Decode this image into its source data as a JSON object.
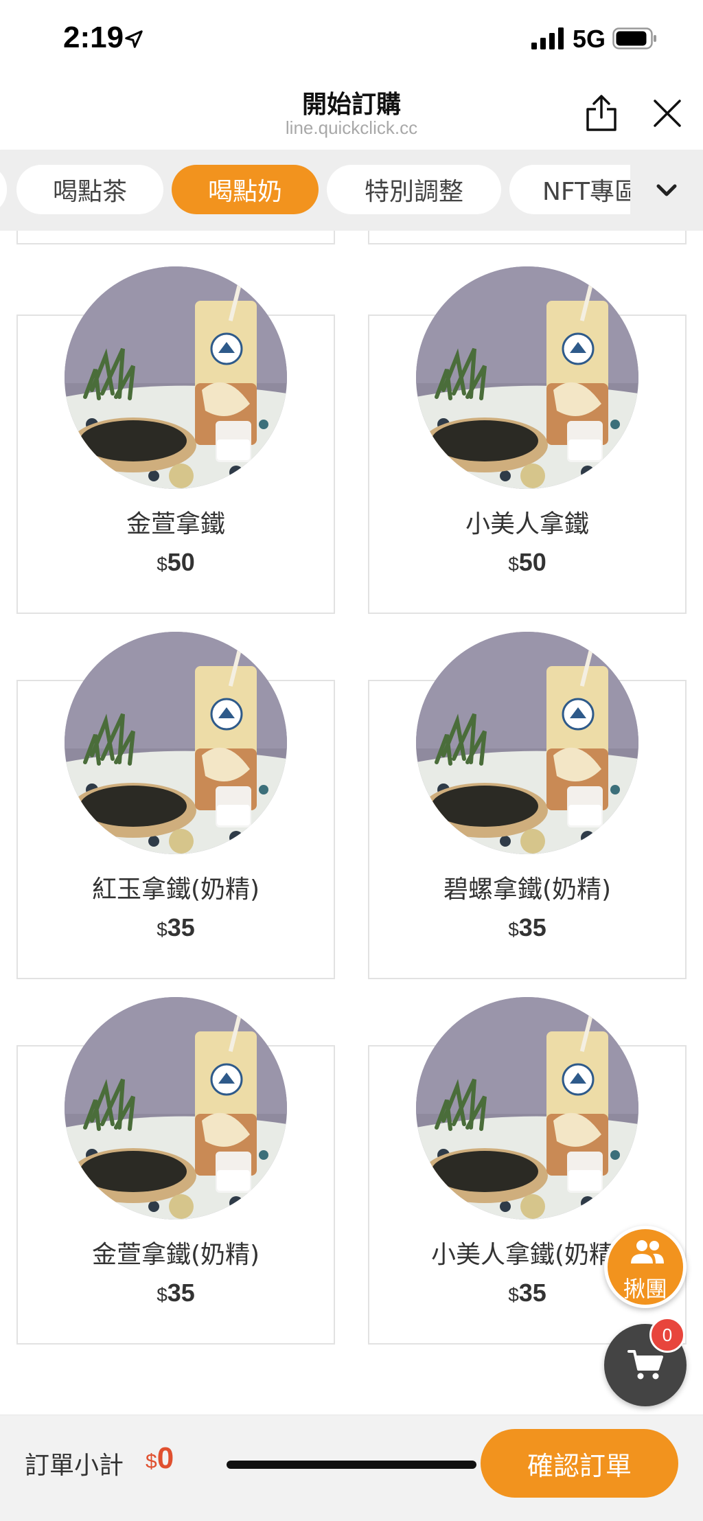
{
  "status_bar": {
    "time": "2:19",
    "network": "5G",
    "icons": [
      "location-arrow-icon",
      "signal-bars-icon",
      "battery-icon"
    ]
  },
  "header": {
    "title": "開始訂購",
    "url": "line.quickclick.cc",
    "icons": [
      "share-icon",
      "close-icon"
    ]
  },
  "tabs": {
    "items": [
      {
        "label": "喝點茶",
        "active": false
      },
      {
        "label": "喝點奶",
        "active": true
      },
      {
        "label": "特別調整",
        "active": false
      },
      {
        "label": "NFT專區",
        "active": false
      }
    ],
    "more_icon": "chevron-down-icon"
  },
  "products": [
    {
      "name": "金萱拿鐵",
      "currency": "$",
      "price": "50"
    },
    {
      "name": "小美人拿鐵",
      "currency": "$",
      "price": "50"
    },
    {
      "name": "紅玉拿鐵(奶精)",
      "currency": "$",
      "price": "35"
    },
    {
      "name": "碧螺拿鐵(奶精)",
      "currency": "$",
      "price": "35"
    },
    {
      "name": "金萱拿鐵(奶精)",
      "currency": "$",
      "price": "35"
    },
    {
      "name": "小美人拿鐵(奶精)",
      "currency": "$",
      "price": "35"
    }
  ],
  "floating": {
    "group_label": "揪團",
    "cart_count": "0"
  },
  "footer": {
    "subtotal_label": "訂單小計",
    "currency": "$",
    "subtotal": "0",
    "confirm_label": "確認訂單"
  },
  "colors": {
    "accent": "#f2931e",
    "price_red": "#e0502f",
    "badge_red": "#e8453c"
  }
}
